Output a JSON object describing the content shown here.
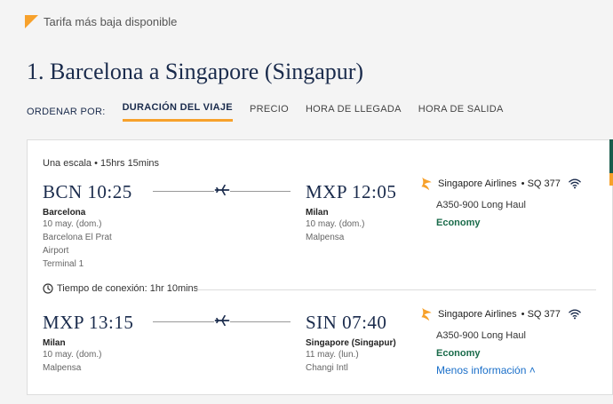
{
  "legend": {
    "text": "Tarifa más baja disponible",
    "color": "#f7a12b"
  },
  "title": "1. Barcelona a Singapore (Singapur)",
  "sort": {
    "label": "ORDENAR POR:",
    "options": [
      "DURACIÓN DEL VIAJE",
      "PRECIO",
      "HORA DE LLEGADA",
      "HORA DE SALIDA"
    ],
    "active": "DURACIÓN DEL VIAJE"
  },
  "itinerary": {
    "stops_summary": "Una escala • 15hrs 15mins",
    "connection": "Tiempo de conexión: 1hr 10mins",
    "segments": [
      {
        "departure": {
          "code_time": "BCN 10:25",
          "city": "Barcelona",
          "date": "10 may. (dom.)",
          "airport_line1": "Barcelona El Prat",
          "airport_line2": "Airport",
          "terminal": "Terminal 1"
        },
        "arrival": {
          "code_time": "MXP 12:05",
          "city": "Milan",
          "date": "10 may. (dom.)",
          "airport_line1": "Malpensa"
        },
        "airline": "Singapore Airlines",
        "flight": "• SQ 377",
        "aircraft": "A350-900 Long Haul",
        "cabin": "Economy"
      },
      {
        "departure": {
          "code_time": "MXP 13:15",
          "city": "Milan",
          "date": "10 may. (dom.)",
          "airport_line1": "Malpensa"
        },
        "arrival": {
          "code_time": "SIN 07:40",
          "city": "Singapore (Singapur)",
          "date": "11 may. (lun.)",
          "airport_line1": "Changi Intl"
        },
        "airline": "Singapore Airlines",
        "flight": "• SQ 377",
        "aircraft": "A350-900 Long Haul",
        "cabin": "Economy",
        "less_info": "Menos información ˄"
      }
    ]
  },
  "colors": {
    "navy": "#1a2b4c",
    "accent": "#f7a12b",
    "economy": "#1a6b4a",
    "link": "#1a6fc9"
  },
  "icons": [
    "plane-icon",
    "wifi-icon",
    "clock-icon",
    "singapore-airlines-logo"
  ]
}
